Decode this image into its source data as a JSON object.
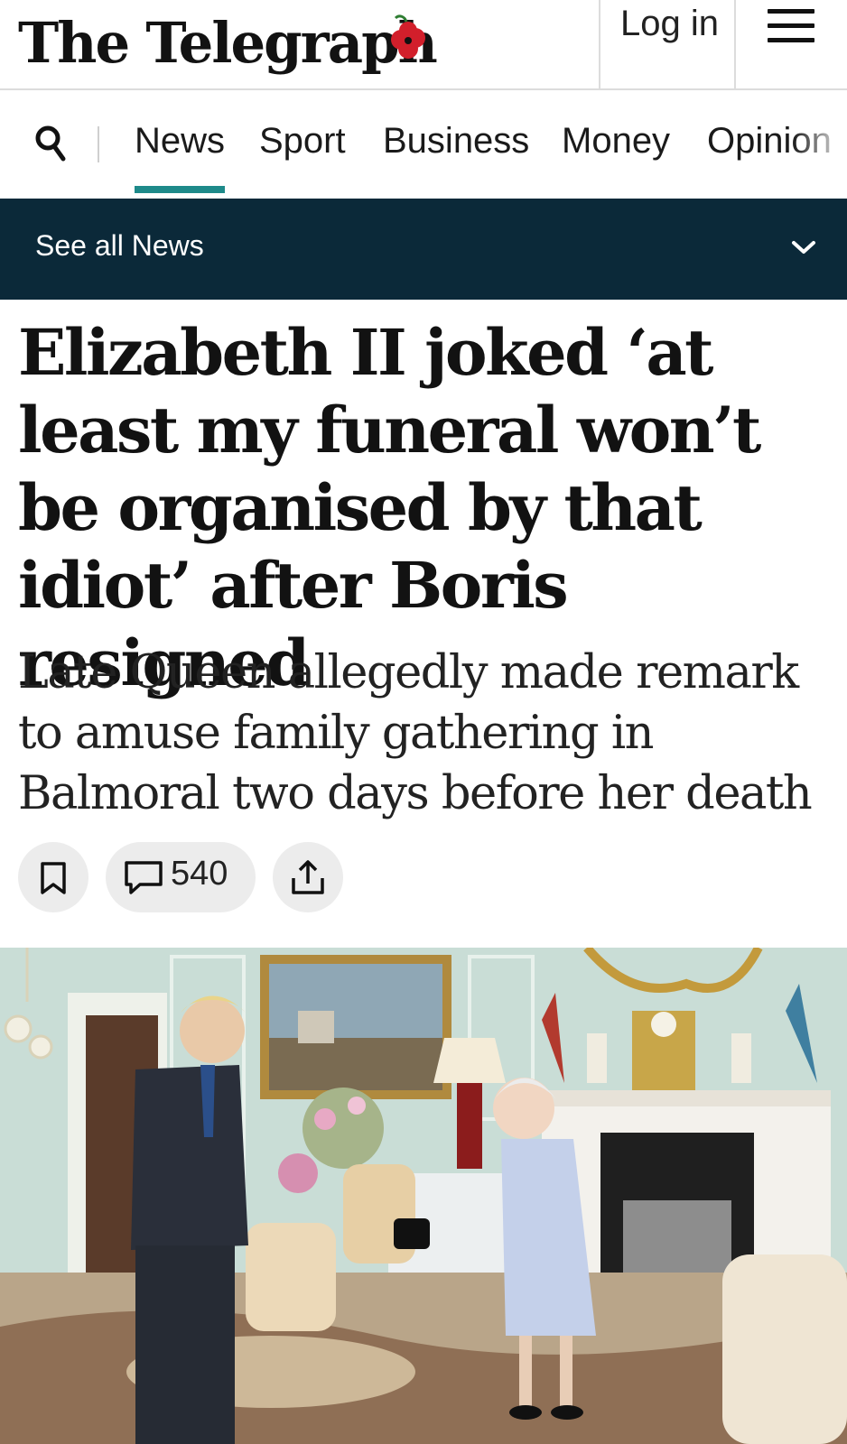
{
  "header": {
    "logo_text": "The Telegraph",
    "login_label": "Log in"
  },
  "nav": {
    "items": [
      {
        "label": "News",
        "active": true
      },
      {
        "label": "Sport",
        "active": false
      },
      {
        "label": "Business",
        "active": false
      },
      {
        "label": "Money",
        "active": false
      },
      {
        "label": "Opinion",
        "active": false
      }
    ]
  },
  "section_bar": {
    "label": "See all News"
  },
  "article": {
    "headline": "Elizabeth II joked ‘at least my funeral won’t be organised by that idiot’ after Boris resigned",
    "standfirst": "Late Queen allegedly made remark to amuse family gathering in Balmoral two days before her death",
    "comment_count": "540"
  },
  "colors": {
    "section_bar": "#0b2939",
    "active_underline": "#1e8a8a",
    "poppy": "#d21f2b"
  },
  "icons": {
    "search": "search-icon",
    "menu": "hamburger-menu-icon",
    "chevron": "chevron-down-icon",
    "bookmark": "bookmark-icon",
    "comment": "comment-icon",
    "share": "share-icon"
  }
}
